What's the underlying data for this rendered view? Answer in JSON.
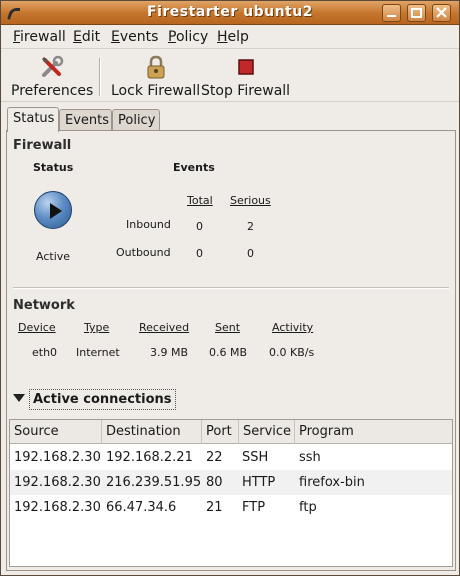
{
  "window": {
    "title": "Firestarter ubuntu2"
  },
  "menu": [
    {
      "label": "Firewall"
    },
    {
      "label": "Edit"
    },
    {
      "label": "Events"
    },
    {
      "label": "Policy"
    },
    {
      "label": "Help"
    }
  ],
  "toolbar": {
    "preferences": "Preferences",
    "lock": "Lock Firewall",
    "stop": "Stop Firewall"
  },
  "tabs": [
    "Status",
    "Events",
    "Policy"
  ],
  "firewall": {
    "section": "Firewall",
    "status_header": "Status",
    "events_header": "Events",
    "total_header": "Total",
    "serious_header": "Serious",
    "state": "Active",
    "inbound_label": "Inbound",
    "outbound_label": "Outbound",
    "inbound_total": "0",
    "inbound_serious": "2",
    "outbound_total": "0",
    "outbound_serious": "0"
  },
  "network": {
    "section": "Network",
    "headers": [
      "Device",
      "Type",
      "Received",
      "Sent",
      "Activity"
    ],
    "row": [
      "eth0",
      "Internet",
      "3.9 MB",
      "0.6 MB",
      "0.0 KB/s"
    ]
  },
  "connections": {
    "expander_label": "Active connections",
    "columns": [
      "Source",
      "Destination",
      "Port",
      "Service",
      "Program"
    ],
    "rows": [
      [
        "192.168.2.30",
        "192.168.2.21",
        "22",
        "SSH",
        "ssh"
      ],
      [
        "192.168.2.30",
        "216.239.51.95",
        "80",
        "HTTP",
        "firefox-bin"
      ],
      [
        "192.168.2.30",
        "66.47.34.6",
        "21",
        "FTP",
        "ftp"
      ]
    ]
  },
  "colors": {
    "titlebar": "#c4742c",
    "window_bg": "#efebe7",
    "play_button": "#5f8ec6"
  }
}
